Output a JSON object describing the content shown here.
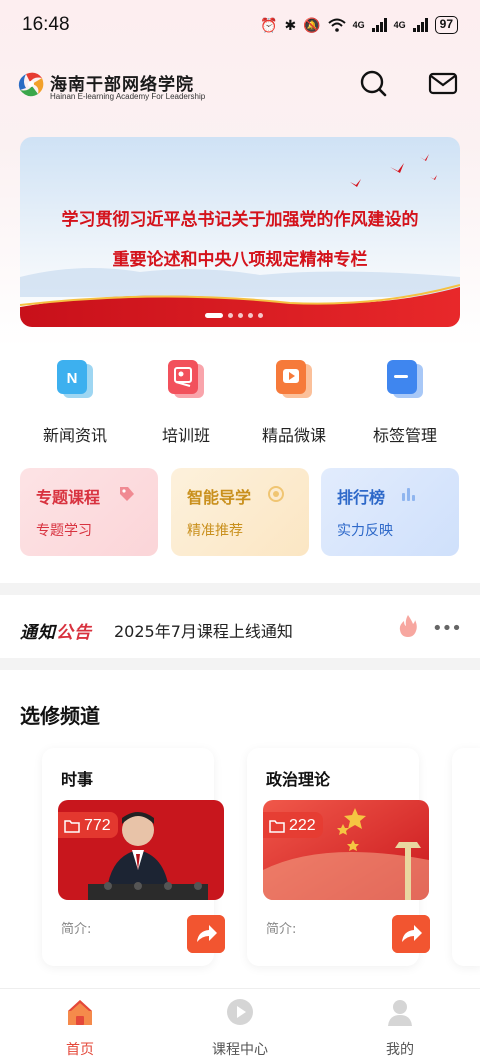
{
  "status_bar": {
    "time": "16:48",
    "network_1": "4G",
    "network_2": "4G",
    "battery": "97"
  },
  "header": {
    "brand_cn": "海南干部网络学院",
    "brand_en": "Hainan E-learning Academy For Leadership",
    "search_icon": "search-icon",
    "mail_icon": "mail-icon"
  },
  "banner": {
    "line1": "学习贯彻习近平总书记关于加强党的作风建设的",
    "line2": "重要论述和中央八项规定精神专栏",
    "slide_count": 5,
    "active_slide": 1
  },
  "quick_links": [
    {
      "label": "新闻资讯",
      "icon": "news-icon"
    },
    {
      "label": "培训班",
      "icon": "training-icon"
    },
    {
      "label": "精品微课",
      "icon": "video-course-icon"
    },
    {
      "label": "标签管理",
      "icon": "tag-icon"
    }
  ],
  "feature_cards": [
    {
      "title": "专题课程",
      "subtitle": "专题学习",
      "icon": "tag-icon"
    },
    {
      "title": "智能导学",
      "subtitle": "精准推荐",
      "icon": "target-icon"
    },
    {
      "title": "排行榜",
      "subtitle": "实力反映",
      "icon": "bar-chart-icon"
    }
  ],
  "notice": {
    "tag_part1": "通知",
    "tag_part2": "公告",
    "text": "2025年7月课程上线通知",
    "more": "•••"
  },
  "elective": {
    "title": "选修频道",
    "channels": [
      {
        "name": "时事",
        "count": "772",
        "desc": "简介:"
      },
      {
        "name": "政治理论",
        "count": "222",
        "desc": "简介:"
      }
    ]
  },
  "tabbar": {
    "tabs": [
      {
        "label": "首页",
        "icon": "home-icon",
        "active": true
      },
      {
        "label": "课程中心",
        "icon": "play-icon",
        "active": false
      },
      {
        "label": "我的",
        "icon": "user-icon",
        "active": false
      }
    ]
  },
  "colors": {
    "accent": "#e4483a",
    "banner_text": "#d4121b",
    "card_red": "#d8323f",
    "card_gold": "#c9901d",
    "card_blue": "#2e69c9"
  }
}
